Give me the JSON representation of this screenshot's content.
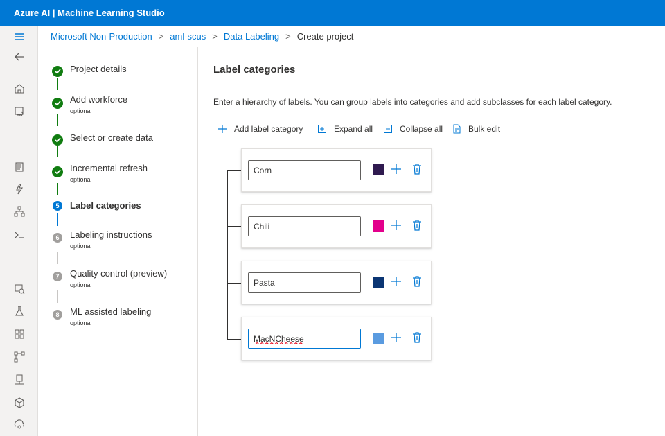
{
  "app": {
    "title": "Azure AI | Machine Learning Studio"
  },
  "breadcrumb": {
    "items": [
      "Microsoft Non-Production",
      "aml-scus",
      "Data Labeling"
    ],
    "current": "Create project",
    "separator": ">"
  },
  "rail_icons": [
    "hamburger-menu-icon",
    "back-arrow-icon",
    "home-icon",
    "model-catalog-icon",
    "notebooks-icon",
    "automated-ml-icon",
    "designer-icon",
    "prompt-flow-icon",
    "data-icon",
    "jobs-icon",
    "components-icon",
    "pipelines-icon",
    "compute-icon",
    "models-icon",
    "endpoints-icon"
  ],
  "steps": [
    {
      "label": "Project details",
      "sub": "",
      "status": "done",
      "number": "1"
    },
    {
      "label": "Add workforce",
      "sub": "optional",
      "status": "done",
      "number": "2"
    },
    {
      "label": "Select or create data",
      "sub": "",
      "status": "done",
      "number": "3"
    },
    {
      "label": "Incremental refresh",
      "sub": "optional",
      "status": "done",
      "number": "4"
    },
    {
      "label": "Label categories",
      "sub": "",
      "status": "active",
      "number": "5"
    },
    {
      "label": "Labeling instructions",
      "sub": "optional",
      "status": "todo",
      "number": "6"
    },
    {
      "label": "Quality control (preview)",
      "sub": "optional",
      "status": "todo",
      "number": "7"
    },
    {
      "label": "ML assisted labeling",
      "sub": "optional",
      "status": "todo",
      "number": "8"
    }
  ],
  "main": {
    "title": "Label categories",
    "description": "Enter a hierarchy of labels. You can group labels into categories and add subclasses for each label category.",
    "toolbar": {
      "add_label_category": "Add label category",
      "expand_all": "Expand all",
      "collapse_all": "Collapse all",
      "bulk_edit": "Bulk edit"
    },
    "labels": [
      {
        "value": "Corn",
        "color": "#2f1a4f"
      },
      {
        "value": "Chili",
        "color": "#e3008c"
      },
      {
        "value": "Pasta",
        "color": "#0b3573"
      },
      {
        "value": "MacNCheese",
        "color": "#5a9be0"
      }
    ]
  },
  "colors": {
    "brand": "#0078d4",
    "success": "#107c10",
    "pending": "#a19f9d"
  }
}
